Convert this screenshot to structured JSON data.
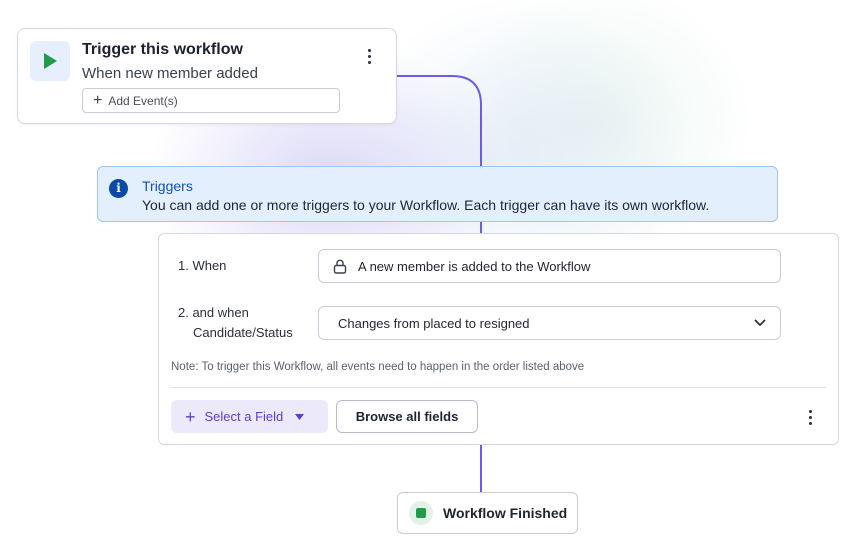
{
  "trigger": {
    "title": "Trigger this workflow",
    "subtitle": "When new member added",
    "add_event_label": "Add Event(s)"
  },
  "info": {
    "title": "Triggers",
    "text": "You can add one or more triggers to your Workflow. Each trigger can have its own workflow."
  },
  "conditions": {
    "row1_label": "1. When",
    "row1_value": "A new member is added to the Workflow",
    "row2_label_line1": "2. and when",
    "row2_label_line2": "Candidate/Status",
    "row2_value": "Changes from placed to resigned",
    "note": "Note: To trigger this Workflow, all events need to happen in the order listed above",
    "select_field_label": "Select a Field",
    "browse_label": "Browse all fields"
  },
  "finished": {
    "label": "Workflow Finished"
  },
  "colors": {
    "accent_purple": "#5a3fc8",
    "connector": "#6b5ce7",
    "info_blue": "#1450b4",
    "play_green": "#1f9b4a"
  },
  "icons": [
    "play-icon",
    "kebab-menu-icon",
    "plus-icon",
    "info-icon",
    "lock-icon",
    "chevron-down-icon",
    "caret-down-icon",
    "stop-icon"
  ]
}
